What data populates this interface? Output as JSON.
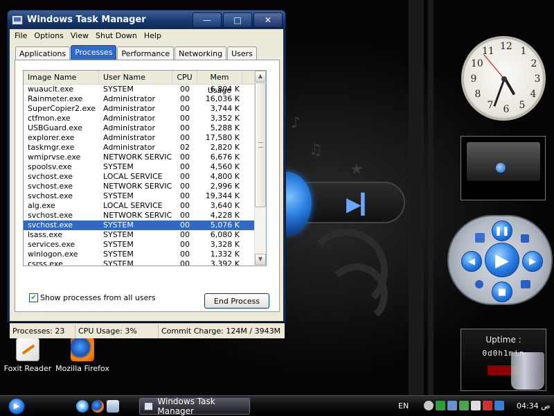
{
  "window": {
    "title": "Windows Task Manager",
    "minimize": "—",
    "maximize": "□",
    "close": "✕"
  },
  "menu": [
    "File",
    "Options",
    "View",
    "Shut Down",
    "Help"
  ],
  "tabs": [
    {
      "label": "Applications",
      "active": false
    },
    {
      "label": "Processes",
      "active": true
    },
    {
      "label": "Performance",
      "active": false
    },
    {
      "label": "Networking",
      "active": false
    },
    {
      "label": "Users",
      "active": false
    }
  ],
  "columns": [
    "Image Name",
    "User Name",
    "CPU",
    "Mem Usage"
  ],
  "processes": [
    {
      "name": "wuauclt.exe",
      "user": "SYSTEM",
      "cpu": "00",
      "mem": "6,804 K"
    },
    {
      "name": "Rainmeter.exe",
      "user": "Administrator",
      "cpu": "00",
      "mem": "16,036 K"
    },
    {
      "name": "SuperCopier2.exe",
      "user": "Administrator",
      "cpu": "00",
      "mem": "3,744 K"
    },
    {
      "name": "ctfmon.exe",
      "user": "Administrator",
      "cpu": "00",
      "mem": "3,352 K"
    },
    {
      "name": "USBGuard.exe",
      "user": "Administrator",
      "cpu": "00",
      "mem": "5,288 K"
    },
    {
      "name": "explorer.exe",
      "user": "Administrator",
      "cpu": "00",
      "mem": "17,580 K"
    },
    {
      "name": "taskmgr.exe",
      "user": "Administrator",
      "cpu": "02",
      "mem": "2,820 K"
    },
    {
      "name": "wmiprvse.exe",
      "user": "NETWORK SERVICE",
      "cpu": "00",
      "mem": "6,676 K"
    },
    {
      "name": "spoolsv.exe",
      "user": "SYSTEM",
      "cpu": "00",
      "mem": "4,560 K"
    },
    {
      "name": "svchost.exe",
      "user": "LOCAL SERVICE",
      "cpu": "00",
      "mem": "4,800 K"
    },
    {
      "name": "svchost.exe",
      "user": "NETWORK SERVICE",
      "cpu": "00",
      "mem": "2,996 K"
    },
    {
      "name": "svchost.exe",
      "user": "SYSTEM",
      "cpu": "00",
      "mem": "19,344 K"
    },
    {
      "name": "alg.exe",
      "user": "LOCAL SERVICE",
      "cpu": "00",
      "mem": "3,640 K"
    },
    {
      "name": "svchost.exe",
      "user": "NETWORK SERVICE",
      "cpu": "00",
      "mem": "4,228 K"
    },
    {
      "name": "svchost.exe",
      "user": "SYSTEM",
      "cpu": "00",
      "mem": "5,076 K",
      "selected": true
    },
    {
      "name": "lsass.exe",
      "user": "SYSTEM",
      "cpu": "00",
      "mem": "6,080 K"
    },
    {
      "name": "services.exe",
      "user": "SYSTEM",
      "cpu": "00",
      "mem": "3,328 K"
    },
    {
      "name": "winlogon.exe",
      "user": "SYSTEM",
      "cpu": "00",
      "mem": "1,332 K"
    },
    {
      "name": "csrss.exe",
      "user": "SYSTEM",
      "cpu": "00",
      "mem": "3,392 K"
    }
  ],
  "show_all": {
    "label": "Show processes from all users",
    "checked": true
  },
  "end_process_label": "End Process",
  "status": {
    "processes": "Processes: 23",
    "cpu": "CPU Usage: 3%",
    "commit": "Commit Charge: 124M / 3943M"
  },
  "desktop_icons": [
    {
      "label": "Foxit Reader",
      "icon": "foxit-reader-icon"
    },
    {
      "label": "Mozilla Firefox",
      "icon": "firefox-icon"
    }
  ],
  "clock_numbers": [
    "12",
    "1",
    "2",
    "3",
    "4",
    "5",
    "6",
    "7",
    "8",
    "9",
    "10",
    "11"
  ],
  "uptime": {
    "label": "Uptime :",
    "value": "0d0h1min"
  },
  "taskbar": {
    "task_label": "Windows Task Manager",
    "language": "EN",
    "time": "04:34 ص"
  }
}
